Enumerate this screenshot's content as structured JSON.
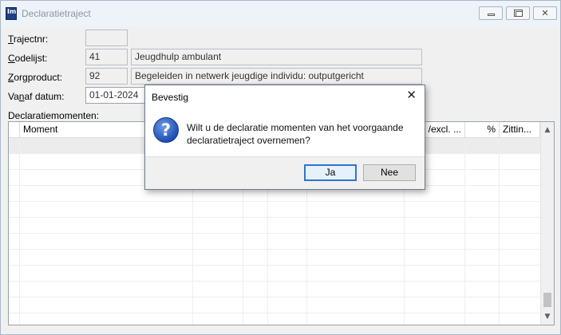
{
  "window": {
    "title": "Declaratietraject",
    "app_icon_text": "Im",
    "controls": {
      "minimize": "minimize",
      "maximize": "maximize",
      "close": "✕"
    }
  },
  "form": {
    "trajectnr": {
      "label_accel": "T",
      "label_rest": "rajectnr:",
      "value": ""
    },
    "codelijst": {
      "label_accel": "C",
      "label_rest": "odelijst:",
      "code": "41",
      "description": "Jeugdhulp ambulant"
    },
    "zorgproduct": {
      "label_accel": "Z",
      "label_rest": "orgproduct:",
      "code": "92",
      "description": "Begeleiden in netwerk jeugdige individu: outputgericht"
    },
    "vanaf_datum": {
      "label_pre": "Va",
      "label_accel": "n",
      "label_rest": "af datum:",
      "value": "01-01-2024"
    },
    "declaratiemomenten_label": "Declaratiemomenten:"
  },
  "grid": {
    "columns": [
      "Moment",
      "",
      "",
      "",
      "",
      "/excl. ...",
      "%",
      "Zittin..."
    ],
    "scroll_up": "▲",
    "scroll_down": "▼"
  },
  "dialog": {
    "title": "Bevestig",
    "close": "✕",
    "icon_text": "?",
    "message": "Wilt u de declaratie momenten van het voorgaande declaratietraject overnemen?",
    "yes_label": "Ja",
    "no_label": "Nee"
  }
}
